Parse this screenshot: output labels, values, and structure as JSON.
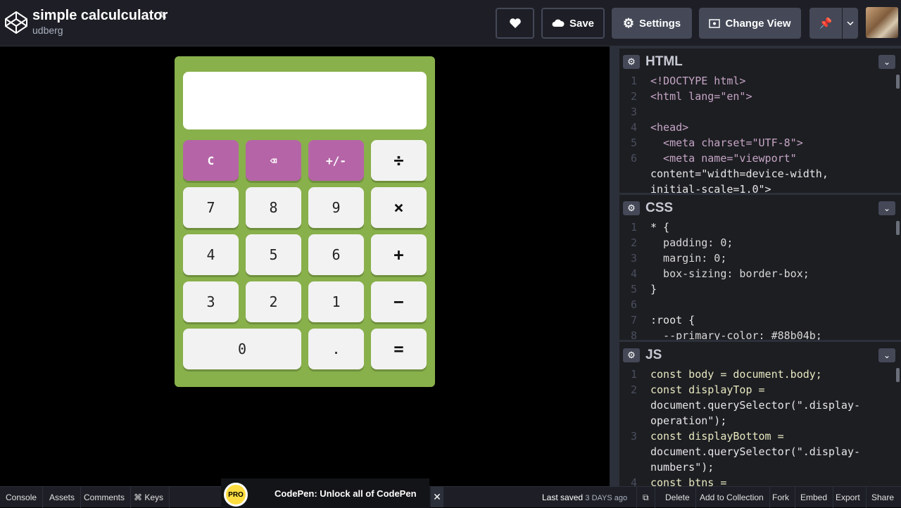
{
  "header": {
    "title": "simple calculculator",
    "owner": "udberg",
    "buttons": {
      "save": "Save",
      "settings": "Settings",
      "change_view": "Change View"
    }
  },
  "calculator": {
    "display_value": "",
    "keys": [
      {
        "label": "C",
        "kind": "op"
      },
      {
        "label": "⌫",
        "kind": "op"
      },
      {
        "label": "+/-",
        "kind": "op"
      },
      {
        "label": "÷",
        "kind": "fn"
      },
      {
        "label": "7",
        "kind": "num"
      },
      {
        "label": "8",
        "kind": "num"
      },
      {
        "label": "9",
        "kind": "num"
      },
      {
        "label": "×",
        "kind": "fn"
      },
      {
        "label": "4",
        "kind": "num"
      },
      {
        "label": "5",
        "kind": "num"
      },
      {
        "label": "6",
        "kind": "num"
      },
      {
        "label": "+",
        "kind": "fn"
      },
      {
        "label": "3",
        "kind": "num"
      },
      {
        "label": "2",
        "kind": "num"
      },
      {
        "label": "1",
        "kind": "num"
      },
      {
        "label": "−",
        "kind": "fn"
      },
      {
        "label": "0",
        "kind": "num"
      },
      {
        "label": ".",
        "kind": "num"
      },
      {
        "label": "=",
        "kind": "fn"
      }
    ]
  },
  "editors": {
    "html": {
      "name": "HTML",
      "lines": [
        {
          "n": "1",
          "t": "<!DOCTYPE html>"
        },
        {
          "n": "2",
          "t": "<html lang=\"en\">"
        },
        {
          "n": "3",
          "t": ""
        },
        {
          "n": "4",
          "t": "<head>"
        },
        {
          "n": "5",
          "t": "  <meta charset=\"UTF-8\">"
        },
        {
          "n": "6",
          "t": "  <meta name=\"viewport\""
        },
        {
          "n": "",
          "t": "content=\"width=device-width,"
        },
        {
          "n": "",
          "t": "initial-scale=1.0\">"
        }
      ]
    },
    "css": {
      "name": "CSS",
      "lines": [
        {
          "n": "1",
          "t": "* {"
        },
        {
          "n": "2",
          "t": "  padding: 0;"
        },
        {
          "n": "3",
          "t": "  margin: 0;"
        },
        {
          "n": "4",
          "t": "  box-sizing: border-box;"
        },
        {
          "n": "5",
          "t": "}"
        },
        {
          "n": "6",
          "t": ""
        },
        {
          "n": "7",
          "t": ":root {"
        },
        {
          "n": "8",
          "t": "  --primary-color: #88b04b;"
        }
      ]
    },
    "js": {
      "name": "JS",
      "lines": [
        {
          "n": "1",
          "t": "const body = document.body;"
        },
        {
          "n": "2",
          "t": "const displayTop ="
        },
        {
          "n": "",
          "t": "document.querySelector(\".display-"
        },
        {
          "n": "",
          "t": "operation\");"
        },
        {
          "n": "3",
          "t": "const displayBottom ="
        },
        {
          "n": "",
          "t": "document.querySelector(\".display-"
        },
        {
          "n": "",
          "t": "numbers\");"
        },
        {
          "n": "4",
          "t": "const btns ="
        }
      ]
    }
  },
  "footer": {
    "left": [
      "Console",
      "Assets",
      "Comments",
      "⌘ Keys"
    ],
    "promo_badge": "PRO",
    "promo_text": "CodePen: Unlock all of CodePen",
    "saved_label": "Last saved",
    "saved_ago": "3 DAYS ago",
    "right": [
      "Delete",
      "Add to Collection",
      "Fork",
      "Embed",
      "Export",
      "Share"
    ]
  },
  "colors": {
    "calculator_body": "#88b04b",
    "operator_key": "#b565a7",
    "editor_bg": "#1d1e22",
    "header_bg": "#1e1f26"
  }
}
